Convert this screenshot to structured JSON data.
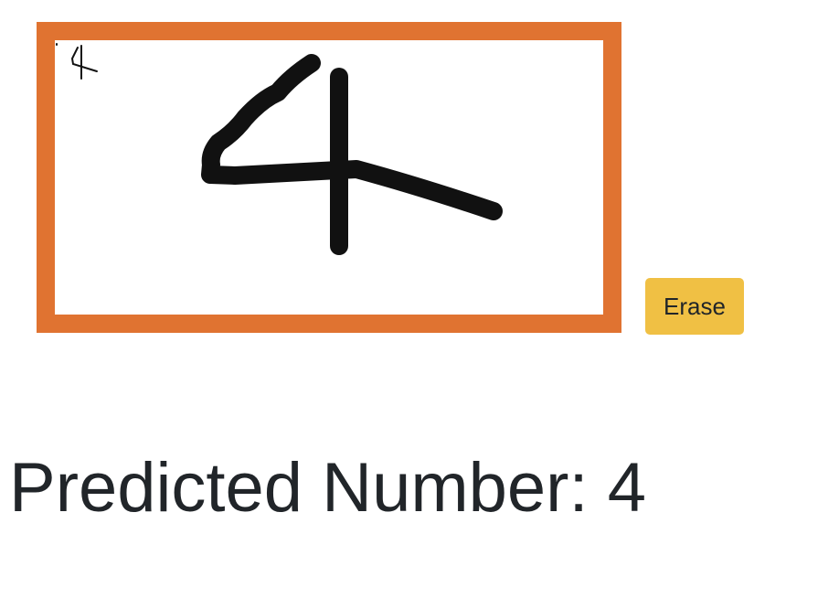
{
  "drawing": {
    "ink_color": "#111111",
    "thumbnail_digit": "4"
  },
  "controls": {
    "erase_label": "Erase",
    "erase_color": "#f0c044"
  },
  "frame": {
    "border_color": "#e07331"
  },
  "result": {
    "label": "Predicted Number:",
    "value": "4"
  }
}
